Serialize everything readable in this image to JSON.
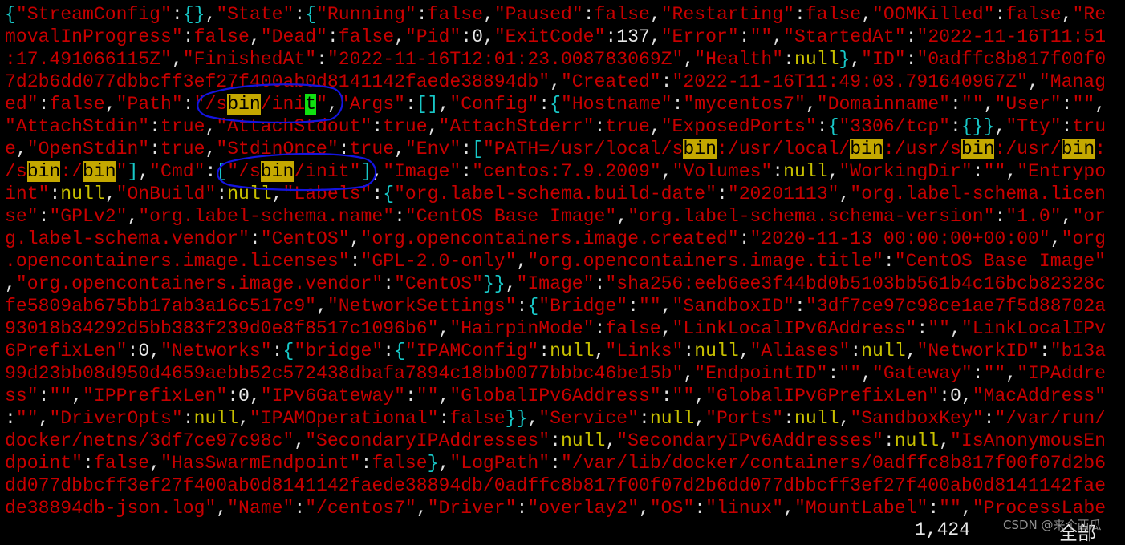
{
  "terminal": {
    "lines": [
      "{\"StreamConfig\":{},\"State\":{\"Running\":false,\"Paused\":false,\"Restarting\":false,\"OOMKilled\":false,\"Re",
      "movalInProgress\":false,\"Dead\":false,\"Pid\":0,\"ExitCode\":137,\"Error\":\"\",\"StartedAt\":\"2022-11-16T11:51",
      ":17.491066115Z\",\"FinishedAt\":\"2022-11-16T12:01:23.008783069Z\",\"Health\":null},\"ID\":\"0adffc8b817f00f0",
      "7d2b6dd077dbbcff3ef27f400ab0d8141142faede38894db\",\"Created\":\"2022-11-16T11:49:03.791640967Z\",\"Manag",
      "ed\":false,\"Path\":\"/sbin/init\",\"Args\":[],\"Config\":{\"Hostname\":\"mycentos7\",\"Domainname\":\"\",\"User\":\"\",",
      "\"AttachStdin\":true,\"AttachStdout\":true,\"AttachStderr\":true,\"ExposedPorts\":{\"3306/tcp\":{}},\"Tty\":tru",
      "e,\"OpenStdin\":true,\"StdinOnce\":true,\"Env\":[\"PATH=/usr/local/sbin:/usr/local/bin:/usr/sbin:/usr/bin:",
      "/sbin:/bin\"],\"Cmd\":[\"/sbin/init\"],\"Image\":\"centos:7.9.2009\",\"Volumes\":null,\"WorkingDir\":\"\",\"Entrypo",
      "int\":null,\"OnBuild\":null,\"Labels\":{\"org.label-schema.build-date\":\"20201113\",\"org.label-schema.licen",
      "se\":\"GPLv2\",\"org.label-schema.name\":\"CentOS Base Image\",\"org.label-schema.schema-version\":\"1.0\",\"or",
      "g.label-schema.vendor\":\"CentOS\",\"org.opencontainers.image.created\":\"2020-11-13 00:00:00+00:00\",\"org",
      ".opencontainers.image.licenses\":\"GPL-2.0-only\",\"org.opencontainers.image.title\":\"CentOS Base Image\"",
      ",\"org.opencontainers.image.vendor\":\"CentOS\"}},\"Image\":\"sha256:eeb6ee3f44bd0b5103bb561b4c16bcb82328c",
      "fe5809ab675bb17ab3a16c517c9\",\"NetworkSettings\":{\"Bridge\":\"\",\"SandboxID\":\"3df7ce97c98ce1ae7f5d88702a",
      "93018b34292d5bb383f239d0e8f8517c1096b6\",\"HairpinMode\":false,\"LinkLocalIPv6Address\":\"\",\"LinkLocalIPv",
      "6PrefixLen\":0,\"Networks\":{\"bridge\":{\"IPAMConfig\":null,\"Links\":null,\"Aliases\":null,\"NetworkID\":\"b13a",
      "99d23bb08d950d4659aebb52c572438dbafa7894c18bb0077bbbc46be15b\",\"EndpointID\":\"\",\"Gateway\":\"\",\"IPAddre",
      "ss\":\"\",\"IPPrefixLen\":0,\"IPv6Gateway\":\"\",\"GlobalIPv6Address\":\"\",\"GlobalIPv6PrefixLen\":0,\"MacAddress\"",
      ":\"\",\"DriverOpts\":null,\"IPAMOperational\":false}},\"Service\":null,\"Ports\":null,\"SandboxKey\":\"/var/run/",
      "docker/netns/3df7ce97c98c\",\"SecondaryIPAddresses\":null,\"SecondaryIPv6Addresses\":null,\"IsAnonymousEn",
      "dpoint\":false,\"HasSwarmEndpoint\":false},\"LogPath\":\"/var/lib/docker/containers/0adffc8b817f00f07d2b6",
      "dd077dbbcff3ef27f400ab0d8141142faede38894db/0adffc8b817f00f07d2b6dd077dbbcff3ef27f400ab0d8141142fae",
      "de38894db-json.log\",\"Name\":\"/centos7\",\"Driver\":\"overlay2\",\"OS\":\"linux\",\"MountLabel\":\"\",\"ProcessLabe"
    ],
    "search_term": "bin",
    "colors": {
      "string": "#c80000",
      "number": "#e8e8e8",
      "null": "#c8c000",
      "bracket": "#18c8c8",
      "search_highlight": "#c4a800",
      "cursor": "#10e010",
      "annotation": "#1414e0"
    }
  },
  "status_bar": {
    "position": "1,424",
    "scroll_indicator": "全部"
  },
  "watermark": "CSDN @来个西瓜"
}
